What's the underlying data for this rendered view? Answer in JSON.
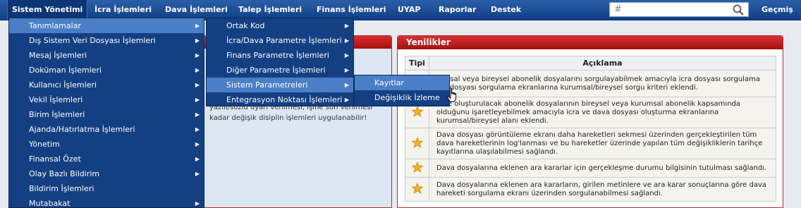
{
  "nav": {
    "items": [
      "Sistem Yönetimi",
      "İcra İşlemleri",
      "Dava İşlemleri",
      "Talep İşlemleri",
      "Finans İşlemleri",
      "UYAP",
      "Raporlar",
      "Destek"
    ],
    "search_placeholder": "#",
    "history_label": "Geçmiş"
  },
  "menu1": {
    "items": [
      "Tanımlamalar",
      "Dış Sistem Veri Dosyası İşlemleri",
      "Mesaj İşlemleri",
      "Doküman İşlemleri",
      "Kullanıcı İşlemleri",
      "Vekil İşlemleri",
      "Birim İşlemleri",
      "Ajanda/Hatırlatma İşlemleri",
      "Yönetim",
      "Finansal Özet",
      "Olay Bazlı Bildirim",
      "Bildirim İşlemleri",
      "Mutabakat"
    ]
  },
  "menu2": {
    "items": [
      "Ortak Kod",
      "İcra/Dava Parametre İşlemleri",
      "Finans Parametre İşlemleri",
      "Diğer Parametre İşlemleri",
      "Sistem Parametreleri",
      "Entegrasyon Noktası İşlemleri"
    ]
  },
  "menu3": {
    "items": [
      "Kayıtlar",
      "Değişiklik İzleme"
    ]
  },
  "left_panel": {
    "text_line1": "yazılı/sözlü uyarı verilmesi, işine son verilmesi",
    "text_line2": "kadar değişik disiplin işlemleri uygulanabilir!"
  },
  "news": {
    "title": "Yenilikler",
    "col_type": "Tipi",
    "col_desc": "Açıklama",
    "rows": [
      "...msal veya bireysel abonelik dosyalarını sorgulayabilmek amacıyla icra dosyası sorgulama ...a dosyası sorgulama ekranlarına kurumsal/bireysel sorgu kriteri eklendi.",
      "...de oluşturulacak abonelik dosyalarının bireysel veya kurumsal abonelik kapsamında olduğunu işaretleyebilmek amacıyla icra ve dava dosyası oluşturma ekranlarına kurumsal/bireysel alanı eklendi.",
      "Dava dosyası görüntüleme ekranı daha hareketleri sekmesi üzerinden gerçekleştirilen tüm dava hareketlerinin log'lanması ve bu hareketler üzerinde yapılan tüm değişikliklerin tarihçe kayıtlarına ulaşılabilmesi sağlandı.",
      "Dava dosyalarına eklenen ara kararlar için gerçekleşme durumu bilgisinin tutulması sağlandı.",
      "Dava dosyalarına eklenen ara kararların, girilen metinlere ve ara karar sonuçlarına göre dava hareketi sorgulama ekranı üzerinden sorgulanabilmesi sağlandı."
    ]
  },
  "colors": {
    "nav_bg": "#1a4c95",
    "menu_bg": "#143f82",
    "menu_highlight": "#4a7fc7",
    "panel_header": "#c41e1e"
  },
  "icons": [
    "search-icon",
    "star-icon",
    "hand-cursor-icon",
    "chevron-right-icon"
  ]
}
